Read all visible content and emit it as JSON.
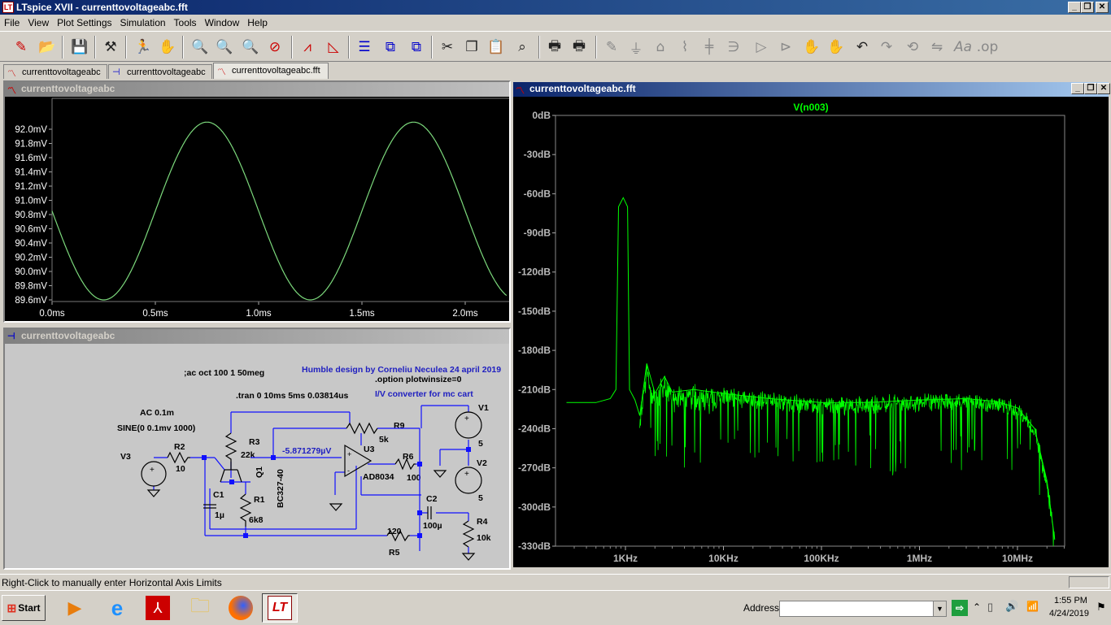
{
  "app": {
    "title": "LTspice XVII - currenttovoltageabc.fft",
    "logo_text": "LT"
  },
  "menu": [
    "File",
    "View",
    "Plot Settings",
    "Simulation",
    "Tools",
    "Window",
    "Help"
  ],
  "toolbar_icons": [
    "new-schematic",
    "open",
    "save",
    "control-panel",
    "run",
    "halt",
    "zoom-in",
    "zoom-pan",
    "zoom-out",
    "zoom-fit",
    "autoscale",
    "tile-horiz",
    "tile-vert",
    "cascade",
    "cut",
    "copy",
    "paste",
    "find",
    "print",
    "print-setup",
    "draw-wire",
    "ground",
    "label",
    "resistor",
    "capacitor",
    "inductor",
    "diode",
    "component",
    "move",
    "drag",
    "undo",
    "redo",
    "rotate",
    "mirror",
    "text",
    "spice-directive"
  ],
  "tabs": [
    {
      "label": "currenttovoltageabc"
    },
    {
      "label": "currenttovoltageabc"
    },
    {
      "label": "currenttovoltageabc.fft"
    }
  ],
  "transient_window": {
    "title": "currenttovoltageabc",
    "y_ticks": [
      "92.0mV",
      "91.8mV",
      "91.6mV",
      "91.4mV",
      "91.2mV",
      "91.0mV",
      "90.8mV",
      "90.6mV",
      "90.4mV",
      "90.2mV",
      "90.0mV",
      "89.8mV",
      "89.6mV"
    ],
    "x_ticks": [
      "0.0ms",
      "0.5ms",
      "1.0ms",
      "1.5ms",
      "2.0ms"
    ],
    "trace_color": "#7cd97c"
  },
  "schematic_window": {
    "title": "currenttovoltageabc",
    "texts": {
      "directive_ac": ";ac oct 100 1 50meg",
      "credit": "Humble design by Corneliu Neculea 24 april 2019",
      "option": ".option plotwinsize=0",
      "tran": ".tran 0 10ms 5ms 0.03814us",
      "desc": "I/V converter for mc cart",
      "v3_ac": "AC 0.1m",
      "v3_sine": "SINE(0 0.1mv 1000)",
      "v3": "V3",
      "r2": "R2",
      "r2v": "10",
      "c1": "C1",
      "c1v": "1µ",
      "r3": "R3",
      "r3v": "22k",
      "q1": "Q1",
      "q1v": "BC327-40",
      "r1": "R1",
      "r1v": "6k8",
      "probe": "-5.871279µV",
      "r9": "R9",
      "r9v": "5k",
      "u3": "U3",
      "u3v": "AD8034",
      "r6": "R6",
      "r6v": "100",
      "v1": "V1",
      "v1v": "5",
      "v2": "V2",
      "v2v": "5",
      "c2": "C2",
      "c2v": "100µ",
      "r4": "R4",
      "r4v": "10k",
      "r5v": "120",
      "r5": "R5"
    }
  },
  "fft_window": {
    "title": "currenttovoltageabc.fft",
    "trace_label": "V(n003)",
    "y_ticks": [
      "0dB",
      "-30dB",
      "-60dB",
      "-90dB",
      "-120dB",
      "-150dB",
      "-180dB",
      "-210dB",
      "-240dB",
      "-270dB",
      "-300dB",
      "-330dB"
    ],
    "x_ticks": [
      "1KHz",
      "10KHz",
      "100KHz",
      "1MHz",
      "10MHz"
    ],
    "trace_color": "#00ff00"
  },
  "chart_data": [
    {
      "type": "line",
      "title": "",
      "x_unit": "ms",
      "y_unit": "mV",
      "xlim": [
        0,
        2.2
      ],
      "ylim": [
        89.6,
        92.1
      ],
      "series": [
        {
          "name": "",
          "form": "sine",
          "frequency_khz": 1.0,
          "amplitude_mv": 1.25,
          "offset_mv": 90.85,
          "min_mv": 89.7,
          "max_mv": 92.0
        }
      ]
    },
    {
      "type": "line",
      "title": "V(n003)",
      "x_scale": "log",
      "xlim": [
        250,
        25000000
      ],
      "ylim": [
        -330,
        0
      ],
      "series": [
        {
          "name": "V(n003)",
          "points": [
            [
              250,
              -220
            ],
            [
              500,
              -220
            ],
            [
              700,
              -217
            ],
            [
              800,
              -210
            ],
            [
              850,
              -70
            ],
            [
              950,
              -63
            ],
            [
              1050,
              -70
            ],
            [
              1100,
              -210
            ],
            [
              1250,
              -218
            ],
            [
              1400,
              -230
            ],
            [
              1650,
              -190
            ],
            [
              2000,
              -213
            ],
            [
              2500,
              -200
            ],
            [
              3000,
              -212
            ],
            [
              5000,
              -210
            ],
            [
              10000,
              -213
            ],
            [
              30000,
              -217
            ],
            [
              100000,
              -220
            ],
            [
              300000,
              -220
            ],
            [
              1000000,
              -218
            ],
            [
              3000000,
              -217
            ],
            [
              6000000,
              -219
            ],
            [
              10000000,
              -224
            ],
            [
              15000000,
              -240
            ],
            [
              20000000,
              -280
            ],
            [
              24000000,
              -325
            ]
          ]
        }
      ]
    }
  ],
  "statusbar": {
    "message": "Right-Click to manually enter Horizontal Axis Limits"
  },
  "taskbar": {
    "start_label": "Start",
    "address_label": "Address",
    "address_value": "",
    "time": "1:55 PM",
    "date": "4/24/2019"
  }
}
